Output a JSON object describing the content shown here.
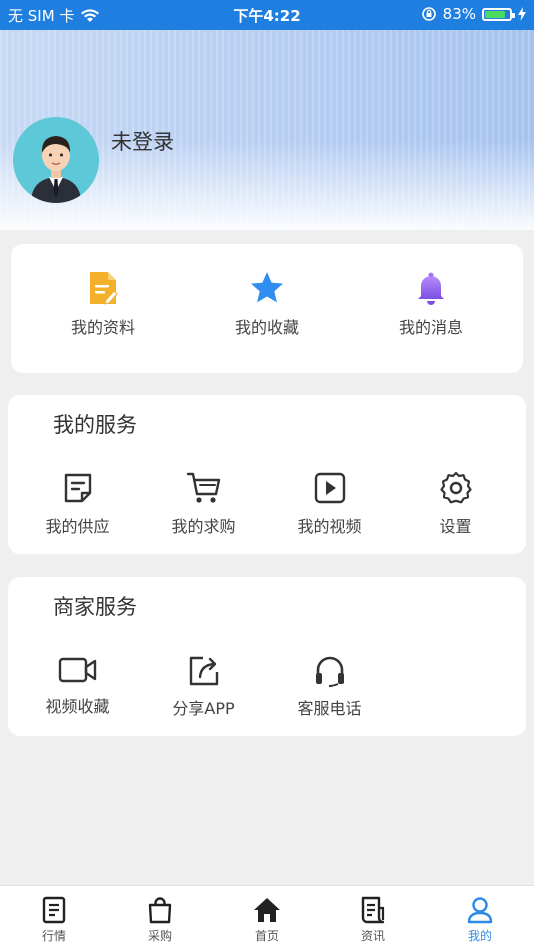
{
  "status_bar": {
    "carrier": "无 SIM 卡",
    "time": "下午4:22",
    "battery": "83%",
    "battery_level": 0.83
  },
  "profile": {
    "username": "未登录",
    "avatar_icon": "person-avatar-icon"
  },
  "quick_actions": [
    {
      "label": "我的资料",
      "icon": "document-edit-icon",
      "color": "#f3b12b"
    },
    {
      "label": "我的收藏",
      "icon": "star-icon",
      "color": "#2f8ef0"
    },
    {
      "label": "我的消息",
      "icon": "bell-icon",
      "color": "#9f6ef3"
    }
  ],
  "my_services": {
    "title": "我的服务",
    "items": [
      {
        "label": "我的供应",
        "icon": "supply-note-icon"
      },
      {
        "label": "我的求购",
        "icon": "shopping-cart-icon"
      },
      {
        "label": "我的视频",
        "icon": "video-play-icon"
      },
      {
        "label": "设置",
        "icon": "gear-icon"
      }
    ]
  },
  "merchant_services": {
    "title": "商家服务",
    "items": [
      {
        "label": "视频收藏",
        "icon": "video-camera-icon"
      },
      {
        "label": "分享APP",
        "icon": "share-icon"
      },
      {
        "label": "客服电话",
        "icon": "headset-icon"
      }
    ]
  },
  "tabbar": {
    "items": [
      {
        "label": "行情",
        "icon": "market-news-icon"
      },
      {
        "label": "采购",
        "icon": "shopping-bag-icon"
      },
      {
        "label": "首页",
        "icon": "home-icon"
      },
      {
        "label": "资讯",
        "icon": "news-icon"
      },
      {
        "label": "我的",
        "icon": "user-icon"
      }
    ],
    "active_color": "#2e8ae6"
  }
}
